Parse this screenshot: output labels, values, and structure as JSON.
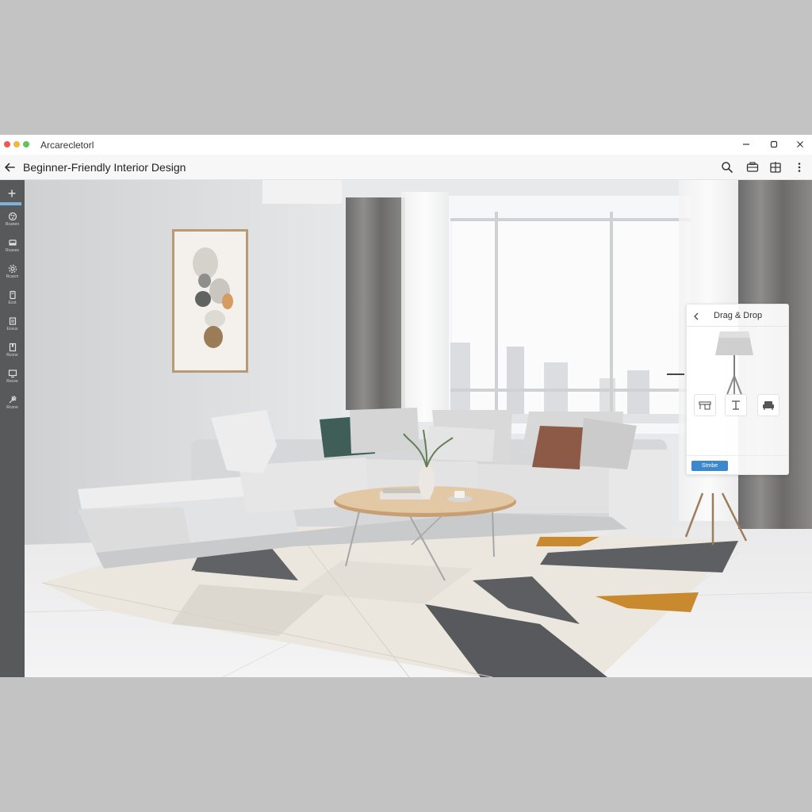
{
  "window": {
    "app_name": "Arcarecletorl",
    "controls": {
      "minimize_icon": "minimize-icon",
      "maximize_icon": "maximize-icon",
      "close_icon": "close-icon"
    }
  },
  "toolbar": {
    "back_icon": "arrow-left-icon",
    "title": "Beginner-Friendly Interior Design",
    "actions": [
      "search-icon",
      "camera-icon",
      "layers-icon",
      "more-vertical-icon"
    ]
  },
  "sidebar": {
    "add_icon": "plus-icon",
    "items": [
      {
        "icon": "palette-icon",
        "label": "Rcanen"
      },
      {
        "icon": "sofa-icon",
        "label": "Rcaoes"
      },
      {
        "icon": "settings-icon",
        "label": "Rcacm"
      },
      {
        "icon": "book-icon",
        "label": "Ecot"
      },
      {
        "icon": "document-icon",
        "label": "Eceus"
      },
      {
        "icon": "bookmark-icon",
        "label": "Rcone"
      },
      {
        "icon": "monitor-icon",
        "label": "Recoe"
      },
      {
        "icon": "tools-icon",
        "label": "Rcone"
      }
    ]
  },
  "drag_drop_panel": {
    "title": "Drag & Drop",
    "back_icon": "chevron-left-icon",
    "preview_icon": "floor-lamp-icon",
    "items": [
      "desk-icon",
      "side-table-icon",
      "armchair-icon"
    ],
    "apply_label": "Stmbe"
  },
  "colors": {
    "sidebar": "#58595b",
    "accent": "#3d87cd",
    "rug_orange": "#c8892f",
    "cushion_green": "#3f5e58",
    "cushion_rust": "#8c5a46"
  }
}
